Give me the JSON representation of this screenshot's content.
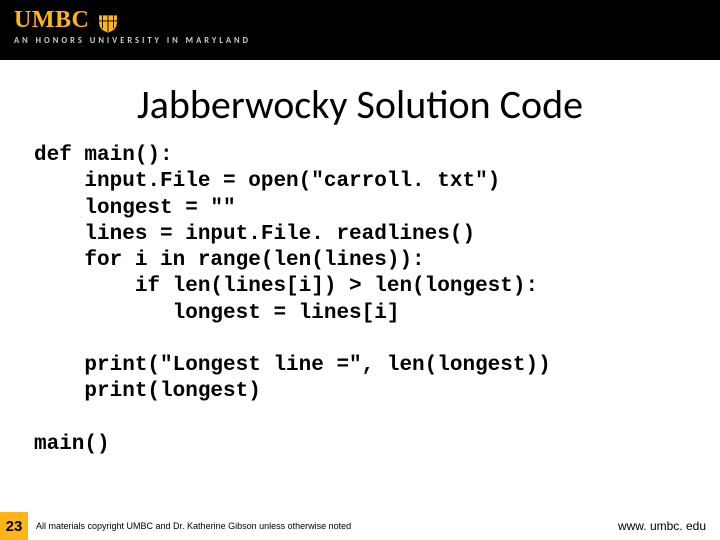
{
  "header": {
    "logo_text": "UMBC",
    "tagline": "AN HONORS UNIVERSITY IN MARYLAND"
  },
  "title": "Jabberwocky Solution Code",
  "code": "def main():\n    input.File = open(\"carroll. txt\")\n    longest = \"\"\n    lines = input.File. readlines()\n    for i in range(len(lines)):\n        if len(lines[i]) > len(longest):\n           longest = lines[i]\n\n    print(\"Longest line =\", len(longest))\n    print(longest)\n\nmain()",
  "footer": {
    "slide_number": "23",
    "copyright": "All materials copyright UMBC and Dr. Katherine Gibson unless otherwise noted",
    "url": "www. umbc. edu"
  }
}
